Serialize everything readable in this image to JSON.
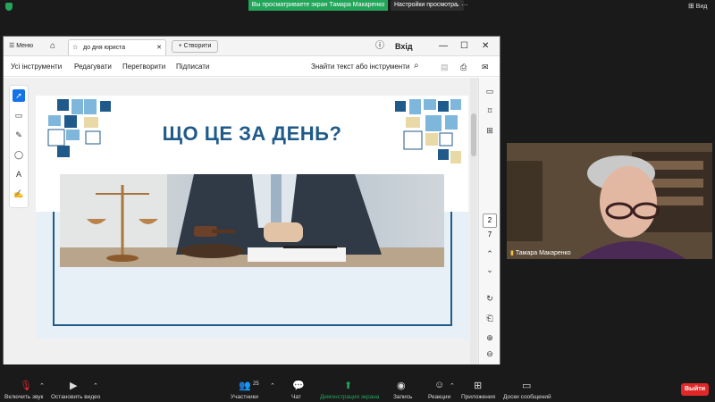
{
  "zoom_bar": {
    "share_banner": "Вы просматриваете экран Тамара Макаренко",
    "view_settings": "Настройки просмотра",
    "view_button": "Вид"
  },
  "acrobat": {
    "menu_label": "Меню",
    "tab_title": "до дня юриста",
    "new_tab_label": "Створити",
    "signin_label": "Вхід",
    "menubar": {
      "all_tools": "Усі інструменти",
      "edit": "Редагувати",
      "convert": "Перетворити",
      "sign": "Підписати",
      "search": "Знайти текст або інструменти"
    },
    "page_number": "2",
    "page_total": "7"
  },
  "slide": {
    "heading": "ЩО ЦЕ ЗА ДЕНЬ?"
  },
  "video": {
    "participant_name": "Тамара Макаренко"
  },
  "bottom_toolbar": {
    "mute": "Включить звук",
    "video": "Остановить видео",
    "participants": "Участники",
    "participants_count": "25",
    "chat": "Чат",
    "share": "Демонстрация экрана",
    "record": "Запись",
    "reactions": "Реакции",
    "apps": "Приложения",
    "whiteboards": "Доски сообщений",
    "leave": "Выйти"
  },
  "colors": {
    "share_green": "#23a55a",
    "leave_red": "#e02828",
    "heading_blue": "#1f5a8a"
  }
}
